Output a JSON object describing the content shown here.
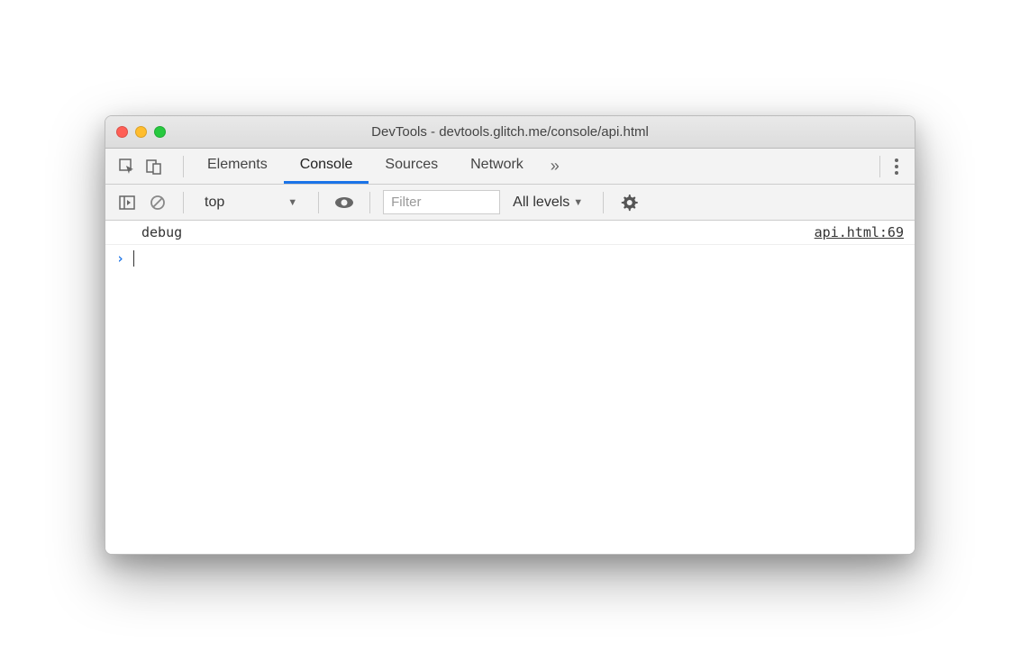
{
  "window": {
    "title": "DevTools - devtools.glitch.me/console/api.html"
  },
  "tabs": {
    "items": [
      {
        "label": "Elements",
        "active": false
      },
      {
        "label": "Console",
        "active": true
      },
      {
        "label": "Sources",
        "active": false
      },
      {
        "label": "Network",
        "active": false
      }
    ],
    "more_symbol": "»"
  },
  "toolbar": {
    "context": "top",
    "filter_placeholder": "Filter",
    "levels_label": "All levels"
  },
  "console": {
    "entries": [
      {
        "message": "debug",
        "source": "api.html:69"
      }
    ],
    "prompt_symbol": "›"
  }
}
